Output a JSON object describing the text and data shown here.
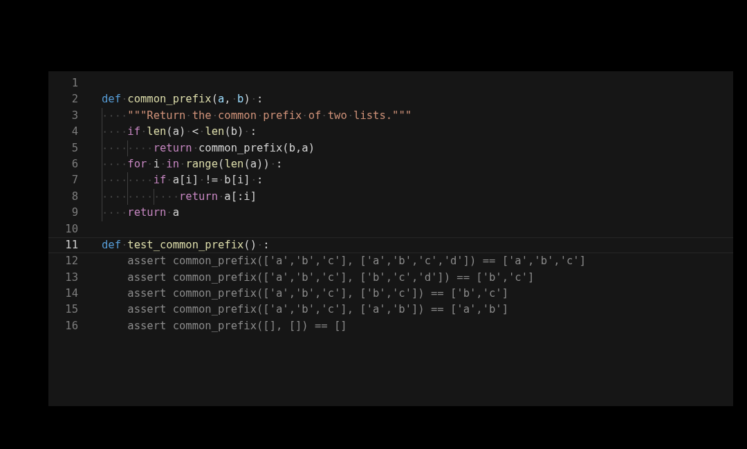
{
  "editor": {
    "lines": [
      {
        "number": "1",
        "current": false
      },
      {
        "number": "2",
        "current": false,
        "ghost": false,
        "tokens": [
          {
            "kind": "keyword",
            "text": "def"
          },
          {
            "kind": "function",
            "text": " common_prefix"
          },
          {
            "kind": "plain",
            "text": "("
          },
          {
            "kind": "param",
            "text": "a"
          },
          {
            "kind": "plain",
            "text": ","
          },
          {
            "kind": "param",
            "text": " b"
          },
          {
            "kind": "plain",
            "text": ") :"
          }
        ]
      },
      {
        "number": "3",
        "current": false,
        "ghost": false,
        "tokens": [
          {
            "kind": "string",
            "text": "    \"\"\"Return the common prefix of two lists.\"\"\""
          }
        ]
      },
      {
        "number": "4",
        "current": false,
        "ghost": false,
        "tokens": [
          {
            "kind": "control",
            "text": "    if"
          },
          {
            "kind": "function",
            "text": " len"
          },
          {
            "kind": "plain",
            "text": "(a) <"
          },
          {
            "kind": "function",
            "text": " len"
          },
          {
            "kind": "plain",
            "text": "(b) :"
          }
        ]
      },
      {
        "number": "5",
        "current": false,
        "ghost": false,
        "tokens": [
          {
            "kind": "control",
            "text": "        return"
          },
          {
            "kind": "plain",
            "text": " common_prefix(b,a)"
          }
        ]
      },
      {
        "number": "6",
        "current": false,
        "ghost": false,
        "tokens": [
          {
            "kind": "control",
            "text": "    for"
          },
          {
            "kind": "plain",
            "text": " i"
          },
          {
            "kind": "control",
            "text": " in"
          },
          {
            "kind": "function",
            "text": " range"
          },
          {
            "kind": "plain",
            "text": "("
          },
          {
            "kind": "function",
            "text": "len"
          },
          {
            "kind": "plain",
            "text": "(a)) :"
          }
        ]
      },
      {
        "number": "7",
        "current": false,
        "ghost": false,
        "tokens": [
          {
            "kind": "control",
            "text": "        if"
          },
          {
            "kind": "plain",
            "text": " a[i] != b[i] :"
          }
        ]
      },
      {
        "number": "8",
        "current": false,
        "ghost": false,
        "tokens": [
          {
            "kind": "control",
            "text": "            return"
          },
          {
            "kind": "plain",
            "text": " a[:i]"
          }
        ]
      },
      {
        "number": "9",
        "current": false,
        "ghost": false,
        "tokens": [
          {
            "kind": "control",
            "text": "    return"
          },
          {
            "kind": "plain",
            "text": " a"
          }
        ]
      },
      {
        "number": "10",
        "current": false
      },
      {
        "number": "11",
        "current": true,
        "ghost": false,
        "tokens": [
          {
            "kind": "keyword",
            "text": "def"
          },
          {
            "kind": "function",
            "text": " test_common_prefix"
          },
          {
            "kind": "plain",
            "text": "() :"
          }
        ]
      },
      {
        "number": "12",
        "current": false,
        "ghost": true,
        "tokens": [
          {
            "kind": "plain",
            "text": "    assert common_prefix(['a','b','c'], ['a','b','c','d']) == ['a','b','c']"
          }
        ]
      },
      {
        "number": "13",
        "current": false,
        "ghost": true,
        "tokens": [
          {
            "kind": "plain",
            "text": "    assert common_prefix(['a','b','c'], ['b','c','d']) == ['b','c']"
          }
        ]
      },
      {
        "number": "14",
        "current": false,
        "ghost": true,
        "tokens": [
          {
            "kind": "plain",
            "text": "    assert common_prefix(['a','b','c'], ['b','c']) == ['b','c']"
          }
        ]
      },
      {
        "number": "15",
        "current": false,
        "ghost": true,
        "tokens": [
          {
            "kind": "plain",
            "text": "    assert common_prefix(['a','b','c'], ['a','b']) == ['a','b']"
          }
        ]
      },
      {
        "number": "16",
        "current": false,
        "ghost": true,
        "tokens": [
          {
            "kind": "plain",
            "text": "    assert common_prefix([], []) == []"
          }
        ]
      }
    ]
  }
}
